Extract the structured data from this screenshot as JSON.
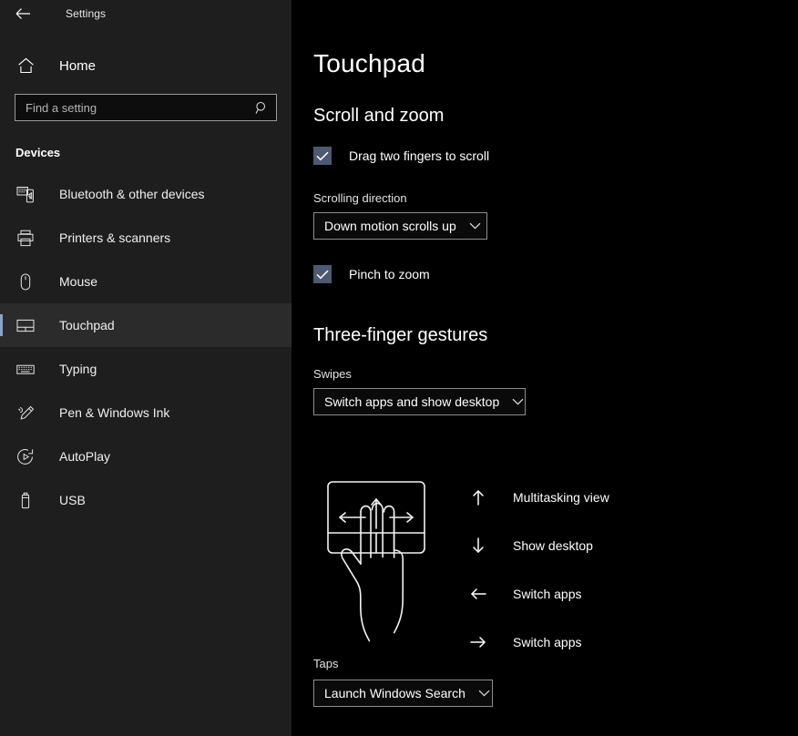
{
  "window": {
    "back_label": "back-arrow",
    "app_title": "Settings"
  },
  "sidebar": {
    "home_label": "Home",
    "search": {
      "placeholder": "Find a setting",
      "value": "",
      "icon": "search-icon"
    },
    "group_label": "Devices",
    "items": [
      {
        "label": "Bluetooth & other devices",
        "icon": "bluetooth-devices-icon",
        "selected": false
      },
      {
        "label": "Printers & scanners",
        "icon": "printer-icon",
        "selected": false
      },
      {
        "label": "Mouse",
        "icon": "mouse-icon",
        "selected": false
      },
      {
        "label": "Touchpad",
        "icon": "touchpad-icon",
        "selected": true
      },
      {
        "label": "Typing",
        "icon": "keyboard-icon",
        "selected": false
      },
      {
        "label": "Pen & Windows Ink",
        "icon": "pen-icon",
        "selected": false
      },
      {
        "label": "AutoPlay",
        "icon": "autoplay-icon",
        "selected": false
      },
      {
        "label": "USB",
        "icon": "usb-icon",
        "selected": false
      }
    ]
  },
  "main": {
    "page_title": "Touchpad",
    "scroll_and_zoom": {
      "heading": "Scroll and zoom",
      "drag_two_fingers": {
        "label": "Drag two fingers to scroll",
        "checked": true
      },
      "scrolling_direction": {
        "label": "Scrolling direction",
        "value": "Down motion scrolls up"
      },
      "pinch_to_zoom": {
        "label": "Pinch to zoom",
        "checked": true
      }
    },
    "three_finger_gestures": {
      "heading": "Three-finger gestures",
      "swipes": {
        "label": "Swipes",
        "value": "Switch apps and show desktop"
      },
      "gesture_legend": [
        {
          "direction": "arrow-up-icon",
          "label": "Multitasking view"
        },
        {
          "direction": "arrow-down-icon",
          "label": "Show desktop"
        },
        {
          "direction": "arrow-left-icon",
          "label": "Switch apps"
        },
        {
          "direction": "arrow-right-icon",
          "label": "Switch apps"
        }
      ],
      "taps": {
        "label": "Taps",
        "value": "Launch Windows Search"
      }
    }
  },
  "colors": {
    "sidebar_bg": "#1e1e1e",
    "main_bg": "#000000",
    "accent_bar": "#8ba3c7",
    "checkbox_fill": "#4b5a70",
    "text_primary": "#ffffff",
    "border": "#8d8d8d"
  }
}
